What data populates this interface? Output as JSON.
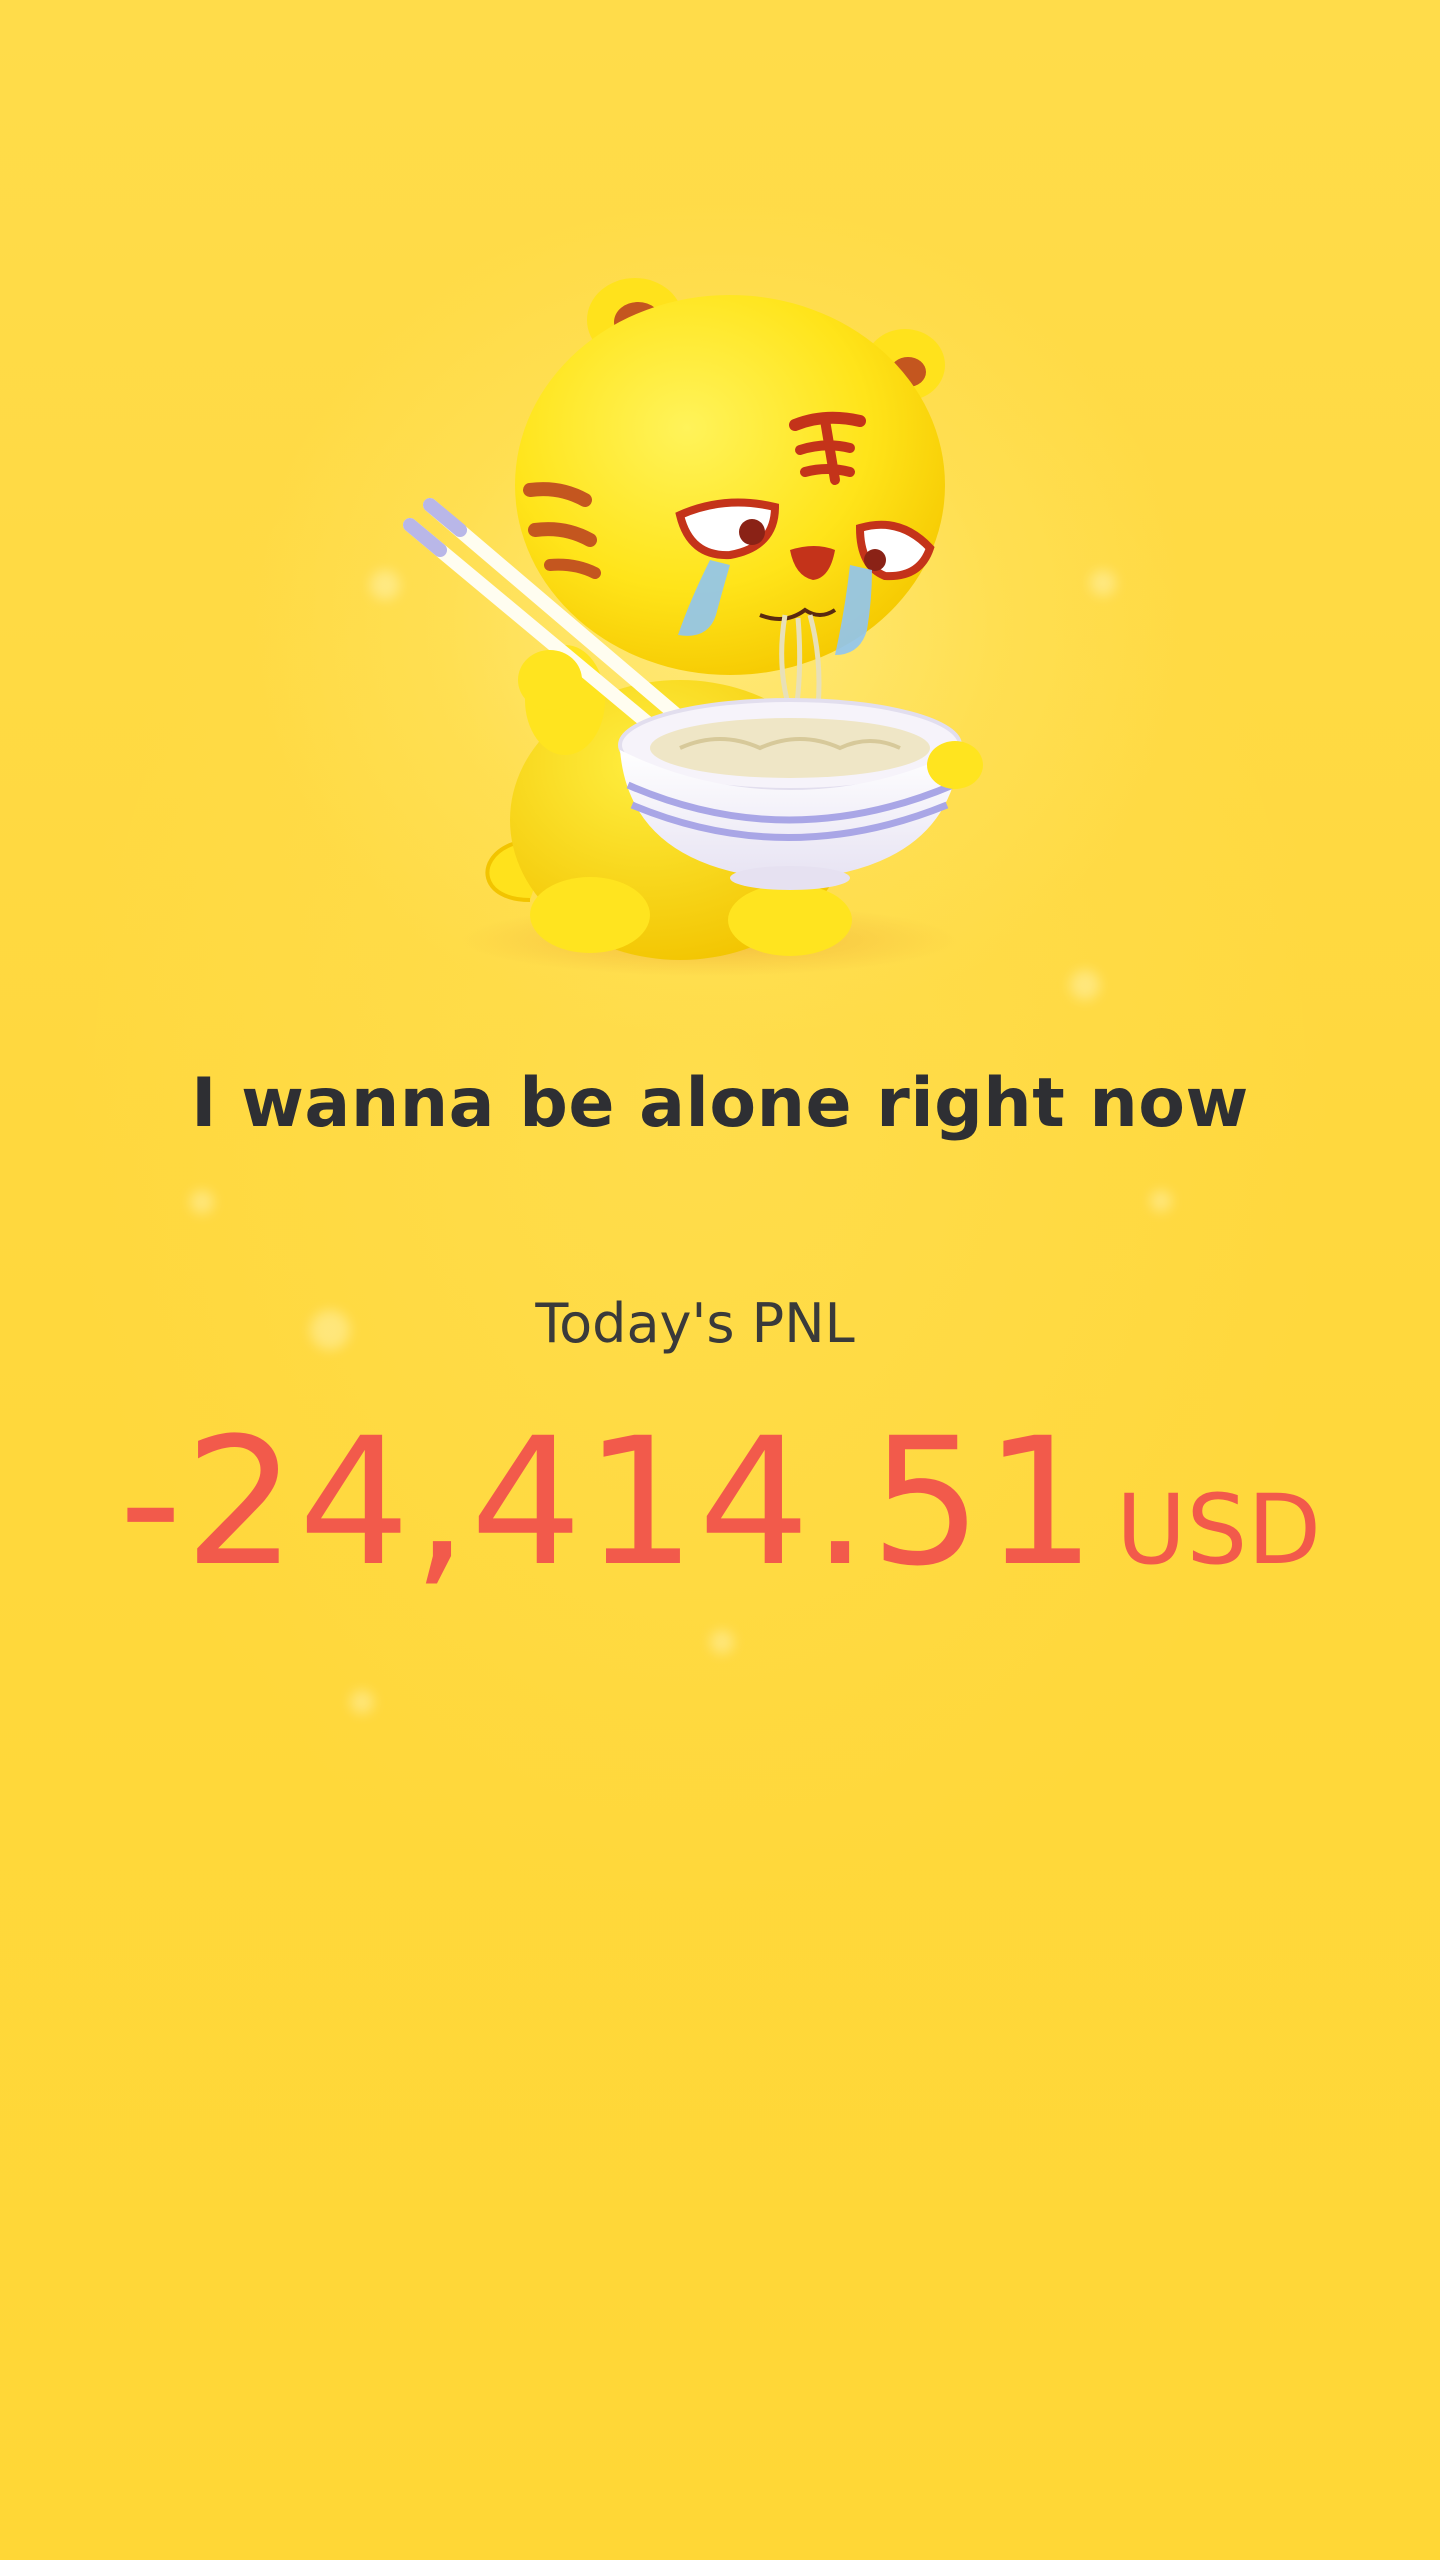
{
  "message": {
    "title": "I wanna be alone right now"
  },
  "pnl": {
    "label": "Today's PNL",
    "value": "-24,414.51",
    "unit": "USD"
  },
  "illustration": {
    "icon": "sad-tiger-eating-noodles-icon"
  },
  "colors": {
    "background": "#FFD93A",
    "loss": "#F25A4B",
    "text": "#2E2F33"
  }
}
